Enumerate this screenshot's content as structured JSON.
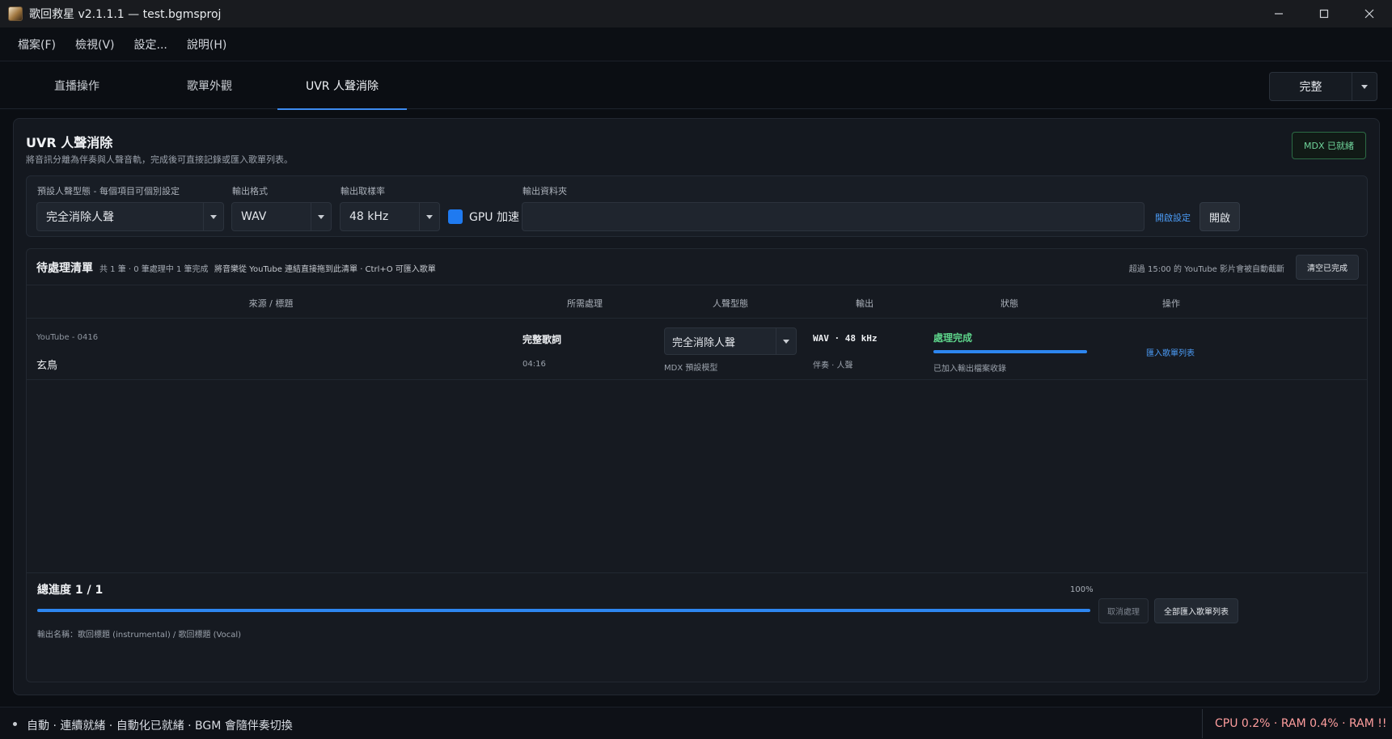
{
  "window": {
    "title": "歌回救星  v2.1.1.1  —  test.bgmsproj"
  },
  "menu": [
    "檔案(F)",
    "檢視(V)",
    "設定...",
    "說明(H)"
  ],
  "tabs": [
    {
      "label": "直播操作",
      "active": false
    },
    {
      "label": "歌單外觀",
      "active": false
    },
    {
      "label": "UVR 人聲消除",
      "active": true
    }
  ],
  "mode_select": {
    "value": "完整"
  },
  "panel": {
    "title": "UVR 人聲消除",
    "subtitle": "將音訊分離為伴奏與人聲音軌，完成後可直接記錄或匯入歌單列表。",
    "status_badge": "MDX 已就緒"
  },
  "settings": {
    "preset_label": "預設人聲型態 - 每個項目可個別設定",
    "preset_value": "完全消除人聲",
    "format_label": "輸出格式",
    "format_value": "WAV",
    "rate_label": "輸出取樣率",
    "rate_value": "48 kHz",
    "gpu_label": "GPU 加速",
    "gpu_checked": true,
    "folder_label": "輸出資料夾",
    "folder_value": "",
    "open_settings_link": "開啟設定",
    "open_button": "開啟"
  },
  "queue": {
    "title": "待處理清單",
    "stats": "共 1 筆 · 0 筆處理中  1 筆完成",
    "hint": "將音樂從 YouTube 連結直接拖到此清單 · Ctrl+O 可匯入歌單",
    "warning": "超過 15:00 的 YouTube 影片會被自動截斷",
    "clear_button": "清空已完成",
    "columns": [
      "來源 / 標題",
      "所需處理",
      "人聲型態",
      "輸出",
      "狀態",
      "操作"
    ],
    "rows": [
      {
        "source": "YouTube - 0416",
        "title": "玄鳥",
        "processing": "完整歌詞",
        "duration": "04:16",
        "vocal_mode": "完全消除人聲",
        "model": "MDX 預設模型",
        "output": "WAV · 48 kHz",
        "tracks": "伴奏 · 人聲",
        "status": "處理完成",
        "progress": 1.0,
        "note": "已加入輸出檔案收錄",
        "action": "匯入歌單列表"
      }
    ]
  },
  "total_progress": {
    "label": "總進度 1 / 1",
    "percent_text": "100%",
    "progress": 1.0,
    "cancel_button": "取消處理",
    "import_all_button": "全部匯入歌單列表",
    "output_names": "輸出名稱：歌回標題 (instrumental) / 歌回標題 (Vocal)"
  },
  "statusbar": {
    "left": "自動 · 連續就緒 · 自動化已就緒 · BGM 會隨伴奏切換",
    "right": "CPU 0.2% · RAM 0.4% · RAM !!"
  },
  "colors": {
    "accent": "#2d86f0",
    "success": "#5dd38a",
    "warning": "#ff9e9e"
  }
}
